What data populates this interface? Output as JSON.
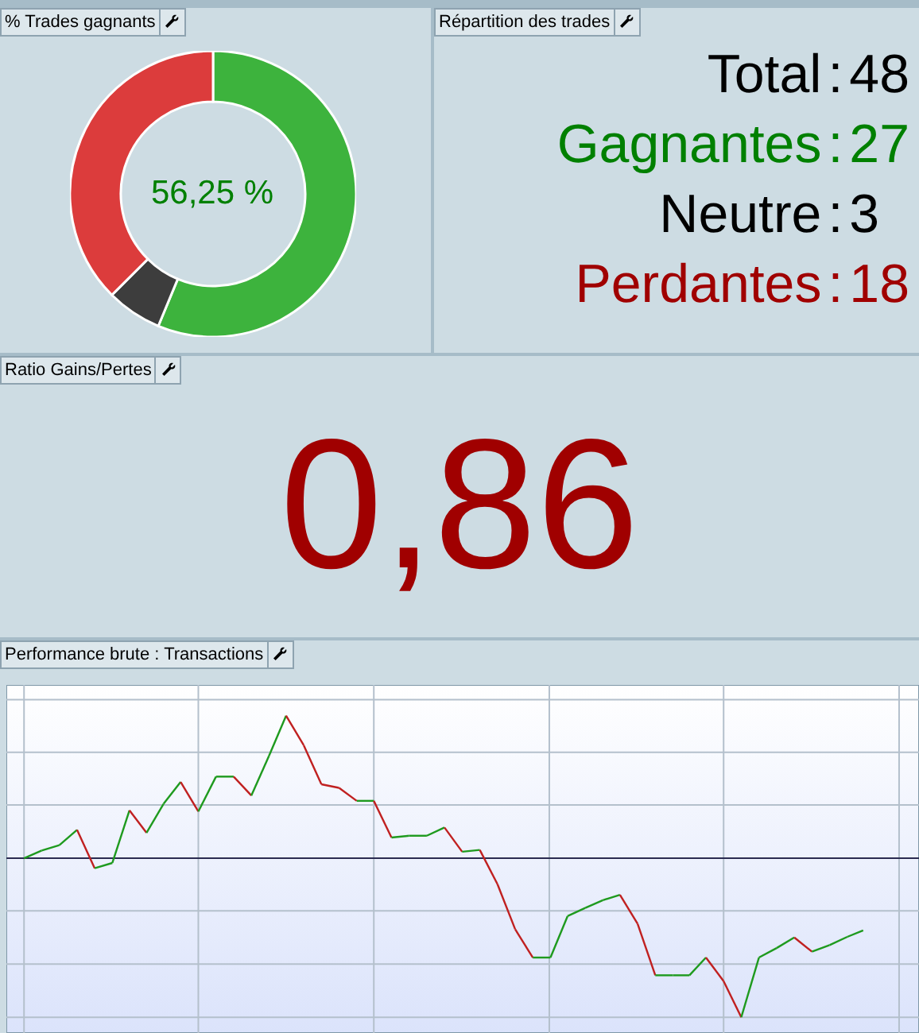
{
  "panels": [
    {
      "title": "% Trades gagnants",
      "center_label": "56,25 %",
      "chart_data": {
        "type": "donut",
        "values": [
          56.25,
          6.25,
          37.5
        ],
        "colors": [
          "#3db33d",
          "#3d3d3d",
          "#dc3c3c"
        ]
      }
    },
    {
      "title": "Répartition des trades",
      "stats": [
        {
          "label": "Total",
          "separator": ":",
          "value": "48",
          "color": "#000000"
        },
        {
          "label": "Gagnantes",
          "separator": ":",
          "value": "27",
          "color": "#008000"
        },
        {
          "label": "Neutre",
          "separator": ":",
          "value": "3",
          "color": "#000000"
        },
        {
          "label": "Perdantes",
          "separator": ":",
          "value": "18",
          "color": "#a00000"
        }
      ]
    },
    {
      "title": "Ratio Gains/Pertes",
      "value": "0,86"
    },
    {
      "title": "Performance brute : Transactions"
    }
  ]
}
